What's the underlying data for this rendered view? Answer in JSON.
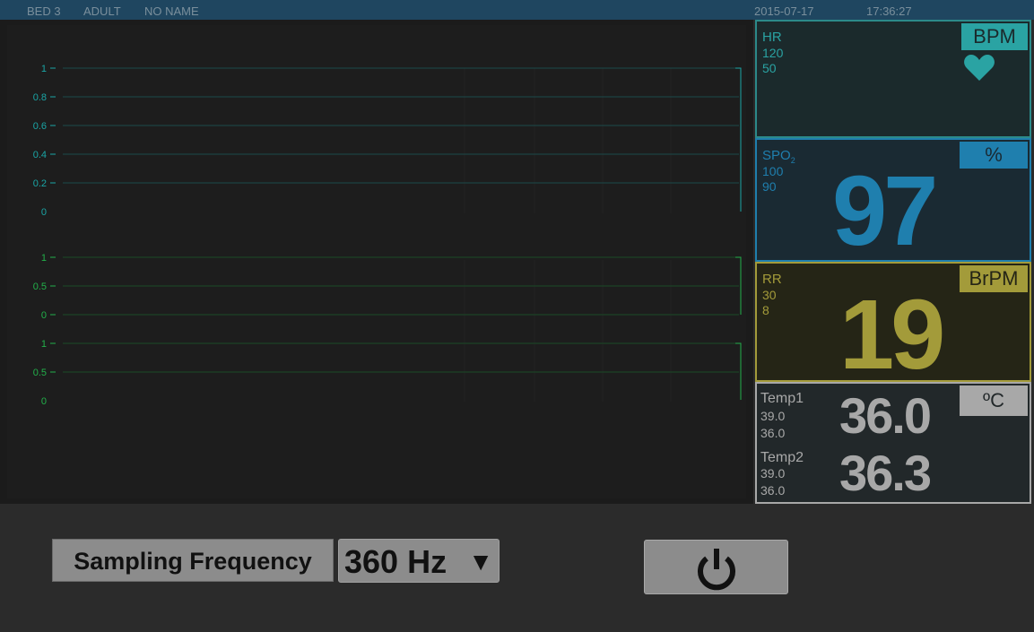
{
  "header": {
    "bed": "BED 3",
    "patient_type": "ADULT",
    "patient_name": "NO NAME",
    "date": "2015-07-17",
    "time": "17:36:27"
  },
  "charts": {
    "upper": {
      "ticks": [
        "1",
        "0.8",
        "0.6",
        "0.4",
        "0.2",
        "0"
      ]
    },
    "lower": {
      "ticks": [
        "1",
        "0.5",
        "0",
        "1",
        "0.5",
        "0"
      ]
    }
  },
  "chart_data": [
    {
      "type": "line",
      "title": "",
      "xlabel": "",
      "ylabel": "",
      "ylim": [
        0,
        1
      ],
      "yticks": [
        "1",
        "0.8",
        "0.6",
        "0.4",
        "0.2",
        "0"
      ],
      "series": [],
      "grid": true
    },
    {
      "type": "line",
      "title": "",
      "xlabel": "",
      "ylabel": "",
      "ylim": [
        0,
        1
      ],
      "yticks": [
        "1",
        "0.5",
        "0"
      ],
      "series": [],
      "grid": true
    },
    {
      "type": "line",
      "title": "",
      "xlabel": "",
      "ylabel": "",
      "ylim": [
        0,
        1
      ],
      "yticks": [
        "1",
        "0.5",
        "0"
      ],
      "series": [],
      "grid": true
    }
  ],
  "vitals": {
    "hr": {
      "label": "HR",
      "high": "120",
      "low": "50",
      "unit": "BPM",
      "icon": "heart-icon",
      "color": "#2aa3a3"
    },
    "spo2": {
      "label": "SPO",
      "label_sub": "2",
      "high": "100",
      "low": "90",
      "value": "97",
      "unit": "%",
      "color": "#1f7fae"
    },
    "rr": {
      "label": "RR",
      "high": "30",
      "low": "8",
      "value": "19",
      "unit": "BrPM",
      "color": "#a39b3a"
    },
    "temp": {
      "unit": "ºC",
      "color": "#a8a8a8",
      "temp1": {
        "label": "Temp1",
        "high": "39.0",
        "low": "36.0",
        "value": "36.0"
      },
      "temp2": {
        "label": "Temp2",
        "high": "39.0",
        "low": "36.0",
        "value": "36.3"
      }
    }
  },
  "controls": {
    "sampling_label": "Sampling Frequency",
    "sampling_value": "360 Hz",
    "dropdown_arrow": "▼",
    "power_icon": "power-icon"
  }
}
